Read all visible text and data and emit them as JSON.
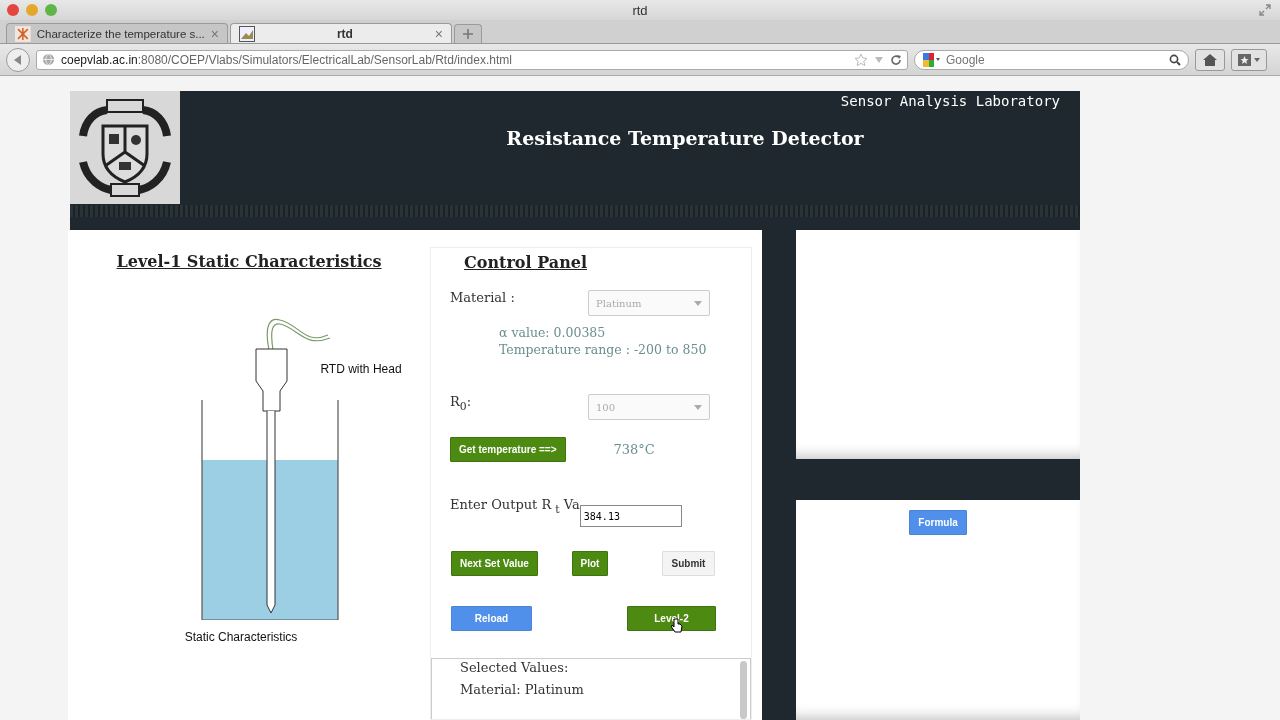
{
  "browser": {
    "window_title": "rtd",
    "tabs": [
      {
        "label": "Characterize the temperature s...",
        "selected": false,
        "close": "×"
      },
      {
        "label": "rtd",
        "selected": true,
        "close": "×"
      }
    ],
    "url_host": "coepvlab.ac.in",
    "url_path": ":8080/COEP/Vlabs/Simulators/ElectricalLab/SensorLab/Rtd/index.html",
    "search": {
      "placeholder": "Google"
    }
  },
  "header": {
    "lab_name": "Sensor Analysis Laboratory",
    "title": "Resistance Temperature Detector"
  },
  "level_panel": {
    "title": "Level-1 Static Characteristics",
    "diagram_label": "RTD with Head",
    "caption": "Static Characteristics"
  },
  "control_panel": {
    "title": "Control Panel",
    "material": {
      "label": "Material :",
      "value": "Platinum",
      "disabled": true
    },
    "alpha": "α value: 0.00385",
    "range": "Temperature range : -200 to 850",
    "r0": {
      "label": "R$_{0}$:",
      "value": "100",
      "disabled": true
    },
    "get_button": {
      "label": "Get temperature ==>",
      "kind": "green"
    },
    "temperature": "738°C",
    "output": {
      "label": "Enter Output R $_{t}$ Va",
      "value": "384.13"
    },
    "row1": [
      {
        "label": "Next Set Value",
        "kind": "green"
      },
      {
        "label": "Plot",
        "kind": "green"
      },
      {
        "label": "Submit",
        "kind": "plain"
      }
    ],
    "row2": [
      {
        "label": "Reload",
        "kind": "blue"
      },
      {
        "label": "Level-2",
        "kind": "green"
      }
    ],
    "selected_values": [
      "Selected Values:",
      "Material: Platinum"
    ]
  },
  "formula_button": {
    "label": "Formula",
    "kind": "blue"
  }
}
